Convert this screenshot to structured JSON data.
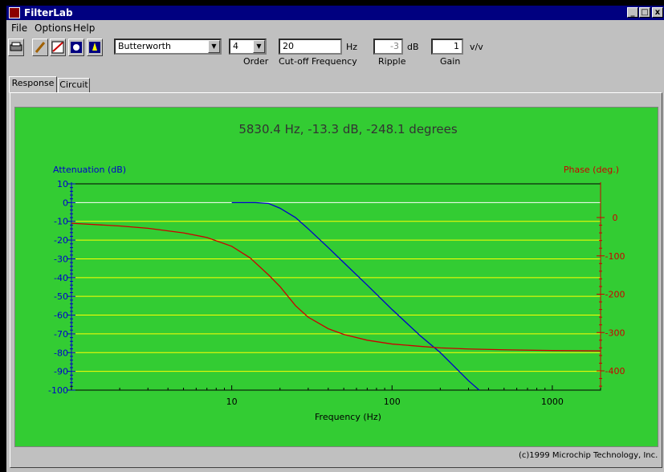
{
  "window": {
    "title": "FilterLab",
    "minimize": "_",
    "maximize": "□",
    "close": "x"
  },
  "menu": [
    "File",
    "Options",
    "Help"
  ],
  "toolbar": {
    "filter_type": "Butterworth",
    "order": "4",
    "order_label": "Order",
    "cutoff": "20",
    "cutoff_unit": "Hz",
    "cutoff_label": "Cut-off Frequency",
    "ripple": "-3",
    "ripple_unit": "dB",
    "ripple_label": "Ripple",
    "gain": "1",
    "gain_unit": "v/v",
    "gain_label": "Gain"
  },
  "tabs": [
    "Response",
    "Circuit"
  ],
  "copyright": "(c)1999 Microchip Technology, Inc.",
  "colors": {
    "plot_bg": "#33cc33",
    "attenuation": "#0000cc",
    "phase": "#cc0000",
    "grid": "#ffff00"
  },
  "chart_data": {
    "type": "line",
    "title": "5830.4 Hz, -13.3 dB, -248.1 degrees",
    "xlabel": "Frequency (Hz)",
    "ylabel": "Attenuation (dB)",
    "y2label": "Phase (deg.)",
    "xscale": "log",
    "xlim": [
      1,
      2000
    ],
    "ylim": [
      -100,
      10
    ],
    "y2lim": [
      -450,
      10
    ],
    "xticks": [
      10,
      100,
      1000
    ],
    "yticks": [
      10,
      0,
      -10,
      -20,
      -30,
      -40,
      -50,
      -60,
      -70,
      -80,
      -90,
      -100
    ],
    "y2ticks": [
      0,
      -100,
      -200,
      -300,
      -400
    ],
    "grid": true,
    "series": [
      {
        "name": "Attenuation (dB)",
        "axis": "left",
        "points": [
          [
            10,
            0
          ],
          [
            14,
            0
          ],
          [
            17,
            -0.5
          ],
          [
            20,
            -3
          ],
          [
            25,
            -8
          ],
          [
            30,
            -14
          ],
          [
            40,
            -24
          ],
          [
            50,
            -32
          ],
          [
            70,
            -44
          ],
          [
            100,
            -57
          ],
          [
            150,
            -71
          ],
          [
            200,
            -80
          ],
          [
            300,
            -95
          ],
          [
            350,
            -100
          ]
        ]
      },
      {
        "name": "Phase (deg.)",
        "axis": "left2",
        "points": [
          [
            1,
            -15
          ],
          [
            2,
            -22
          ],
          [
            3,
            -28
          ],
          [
            5,
            -40
          ],
          [
            7,
            -52
          ],
          [
            10,
            -75
          ],
          [
            13,
            -105
          ],
          [
            17,
            -150
          ],
          [
            20,
            -180
          ],
          [
            25,
            -230
          ],
          [
            30,
            -260
          ],
          [
            40,
            -290
          ],
          [
            50,
            -305
          ],
          [
            70,
            -320
          ],
          [
            100,
            -330
          ],
          [
            150,
            -336
          ],
          [
            200,
            -340
          ],
          [
            300,
            -343
          ],
          [
            500,
            -345
          ],
          [
            1000,
            -347
          ],
          [
            2000,
            -348
          ]
        ]
      }
    ]
  }
}
